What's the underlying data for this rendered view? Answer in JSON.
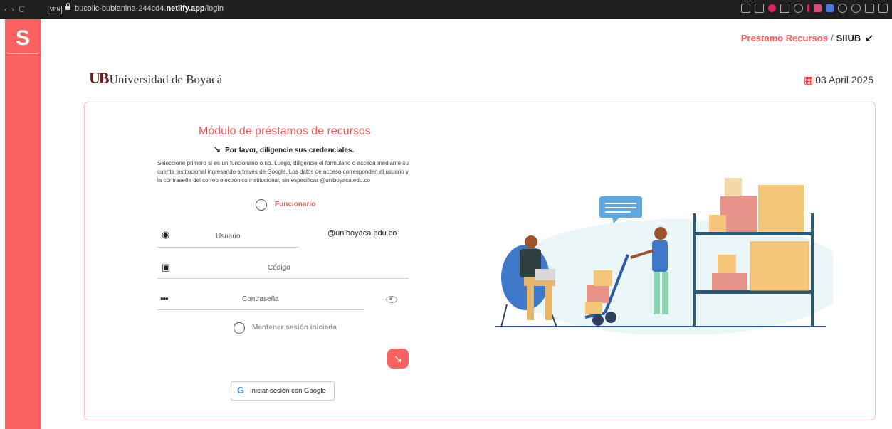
{
  "browser": {
    "vpn": "VPN",
    "url_prefix": "bucolic-bublanina-244cd4.",
    "url_domain": "netlify.app",
    "url_path": "/login"
  },
  "sidebar": {
    "logo": "S"
  },
  "breadcrumb": {
    "parent": "Prestamo Recursos",
    "separator": "/",
    "current": "SIIUB",
    "arrow": "↙"
  },
  "header": {
    "logo_mark": "UB",
    "logo_text": "Universidad de Boyacá",
    "date": "03 April 2025"
  },
  "login": {
    "title": "Módulo de préstamos de recursos",
    "subtitle_arrow": "↘",
    "subtitle": "Por favor, diligencie sus credenciales.",
    "description": "Seleccione primero si es un funcionario o no. Luego, diligencie el formulario o acceda mediante su cuenta institucional ingresando a través de Google. Los datos de acceso corresponden al usuario y la contraseña del correo electrónico institucional, sin especificar @uniboyaca.edu.co",
    "funcionario_label": "Funcionario",
    "usuario_placeholder": "Usuario",
    "domain_suffix": "@uniboyaca.edu.co",
    "codigo_placeholder": "Código",
    "password_placeholder": "Contraseña",
    "keep_session_label": "Mantener sesión iniciada",
    "submit_icon": "↘",
    "google_icon": "G",
    "google_label": "Iniciar sesión con Google"
  },
  "colors": {
    "accent": "#fc6262",
    "card_border": "#f4c3c3",
    "title": "#f0595a"
  }
}
